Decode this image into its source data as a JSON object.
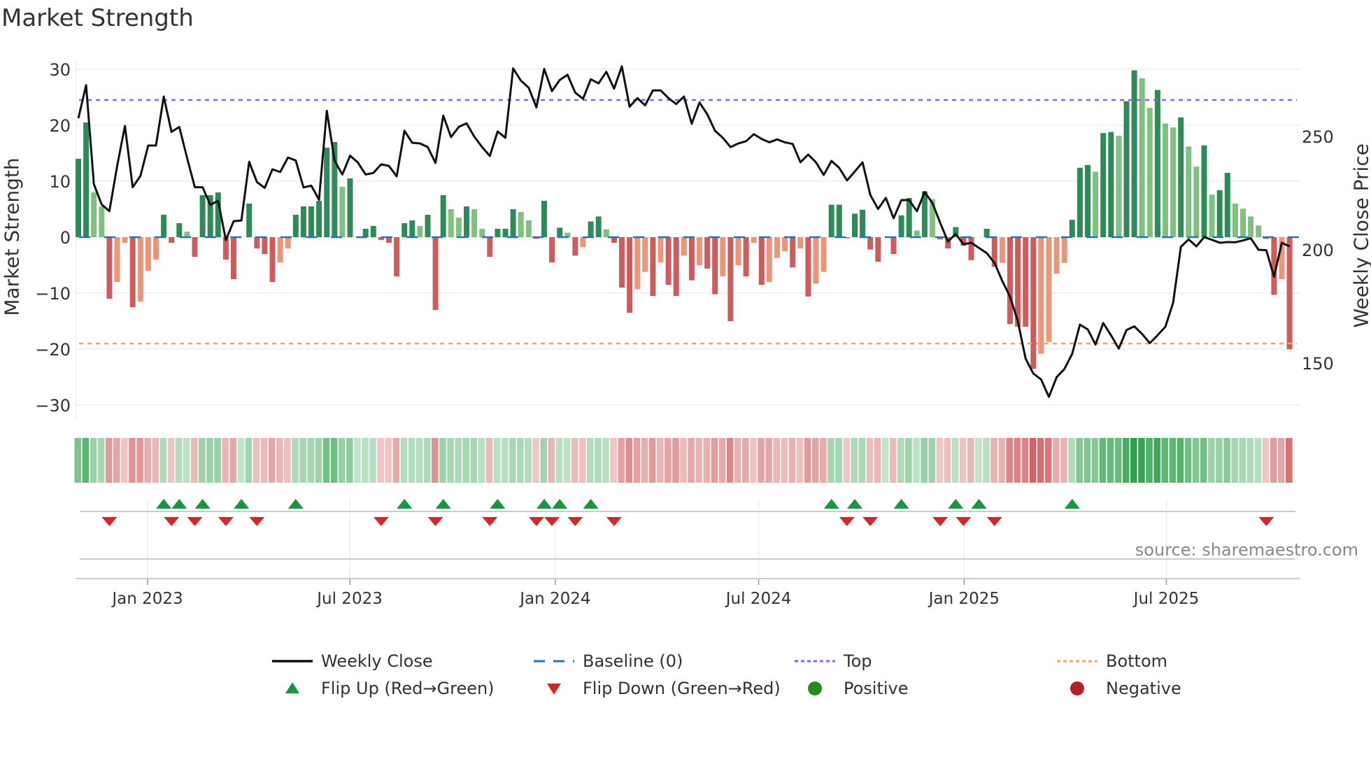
{
  "title": "Market Strength",
  "source": "source: sharemaestro.com",
  "legend": [
    {
      "label": "Weekly Close",
      "symbol": "line",
      "color": "#111111"
    },
    {
      "label": "Baseline (0)",
      "symbol": "dashed",
      "color": "#1f77b4"
    },
    {
      "label": "Top",
      "symbol": "dotted",
      "color": "#9b5de5"
    },
    {
      "label": "Bottom",
      "symbol": "dotted",
      "color": "#f4a261"
    },
    {
      "label": "Flip Up (Red→Green)",
      "symbol": "triangle-up",
      "color": "#1a9641"
    },
    {
      "label": "Flip Down (Green→Red)",
      "symbol": "triangle-down",
      "color": "#d62728"
    },
    {
      "label": "Positive",
      "symbol": "circle",
      "color": "#228b22"
    },
    {
      "label": "Negative",
      "symbol": "circle",
      "color": "#b22222"
    }
  ],
  "chart_data": {
    "type": "bar",
    "title": "Market Strength",
    "ylabel": "Market Strength",
    "y2label": "Weekly Close Price",
    "ylim": [
      -32,
      32
    ],
    "y2lim": [
      133.5,
      282
    ],
    "yticks": [
      30,
      20,
      10,
      0,
      -10,
      -20,
      -30
    ],
    "ytick_labels": [
      "30",
      "20",
      "10",
      "0",
      "−10",
      "−20",
      "−30"
    ],
    "y2ticks": [
      250,
      200,
      150
    ],
    "y2tick_labels": [
      "250",
      "200",
      "150"
    ],
    "xticks": [
      "Jan 2023",
      "Jul 2023",
      "Jan 2024",
      "Jul 2024",
      "Jan 2025",
      "Jul 2025"
    ],
    "xtick_days_from_2023_01_01": [
      0,
      181,
      365,
      547,
      731,
      912
    ],
    "frequency": "weekly",
    "top_level": 24.5,
    "bottom_level": -19,
    "baseline": 0,
    "colors": {
      "strong_pos": "#2e8b57",
      "weak_pos": "#80c080",
      "strong_neg": "#cd5c5c",
      "weak_neg": "#e9967a"
    },
    "strength": [
      14,
      20.5,
      8,
      5.5,
      -11,
      -8,
      -1,
      -12.5,
      -11.5,
      -6,
      -4,
      4,
      -1,
      2.5,
      1,
      -3.5,
      7.5,
      7.5,
      8,
      -4,
      -7.5,
      0,
      6,
      -2,
      -3,
      -8,
      -4.5,
      -2,
      4,
      5.5,
      5.5,
      6.5,
      16,
      17,
      9,
      10.5,
      0,
      1.5,
      2,
      -0.5,
      -1,
      -7,
      2.5,
      3,
      2,
      4,
      -13,
      7.5,
      5,
      3.5,
      5.5,
      5,
      1.5,
      -3.5,
      1.5,
      1.5,
      5,
      4.5,
      3,
      -0.3,
      6.5,
      -4.5,
      1.7,
      0.8,
      -3.3,
      -1.8,
      2.8,
      3.7,
      1.4,
      -1,
      -9,
      -13.5,
      -9.3,
      -6.2,
      -10.5,
      -4.5,
      -8.5,
      -10.5,
      -3.3,
      -7.7,
      -5,
      -5.6,
      -10.2,
      -7,
      -15,
      -5,
      -7,
      -1,
      -8.5,
      -8,
      -3.7,
      -2.5,
      -5.4,
      -2,
      -10.6,
      -8.3,
      -6.2,
      5.8,
      5.8,
      -0.2,
      4.2,
      4.9,
      -2.2,
      -4.4,
      0,
      -3,
      3.9,
      7,
      1.2,
      8.2,
      6.8,
      -0.4,
      -2,
      1.8,
      -1.5,
      -4.1,
      0,
      1.5,
      -5.3,
      -4.6,
      -15.5,
      -16,
      -16,
      -23.5,
      -20.8,
      -18.7,
      -6.5,
      -4.6,
      3.1,
      12.4,
      12.9,
      11.7,
      18.6,
      18.8,
      18.1,
      24.3,
      29.8,
      28.4,
      23.1,
      26.3,
      20.3,
      19.6,
      21.4,
      16.2,
      12.6,
      16.4,
      7.6,
      8.4,
      11.5,
      6,
      5.1,
      3.7,
      2.1,
      -0.3,
      -10.3,
      -7.5,
      -20
    ],
    "close": [
      258,
      272.6,
      229,
      220,
      217,
      237,
      254.6,
      227.6,
      232.6,
      246,
      246,
      267.6,
      252,
      254.2,
      240.6,
      227.6,
      227.6,
      219.8,
      221.6,
      204.3,
      212.6,
      212.9,
      238.8,
      229.9,
      227.3,
      235.5,
      234.3,
      240.7,
      239.4,
      227.5,
      228.3,
      222.1,
      261.3,
      239.3,
      233.2,
      241.5,
      238.5,
      233.2,
      233.9,
      237.7,
      237,
      232.4,
      252.5,
      247.2,
      246.9,
      245.3,
      238.3,
      259.2,
      249.7,
      254.2,
      255.8,
      249.9,
      245.3,
      241.4,
      252.2,
      249.4,
      280,
      274.6,
      271.5,
      262.8,
      279.8,
      270,
      274.9,
      277.2,
      269.3,
      266.6,
      275.2,
      273.4,
      278.5,
      271.1,
      280.9,
      263.1,
      266.9,
      263.7,
      270.3,
      270.3,
      266.9,
      264.3,
      267.6,
      255.6,
      265,
      259.8,
      252.5,
      249.4,
      245.3,
      246.9,
      247.9,
      251,
      248.9,
      247.4,
      248.7,
      247.4,
      246.7,
      238.6,
      242,
      238.6,
      233,
      239.2,
      236.1,
      230.6,
      234.5,
      238.6,
      224.2,
      218,
      222.9,
      213.9,
      221.9,
      221.9,
      217,
      225.5,
      220.6,
      211.9,
      203.6,
      207,
      202.4,
      203.1,
      200.8,
      198.5,
      194.2,
      186.2,
      179.3,
      168.5,
      152,
      145.4,
      142.8,
      135.1,
      143.8,
      147.4,
      154.1,
      167,
      164.9,
      158.2,
      167.7,
      162.3,
      156.4,
      164.6,
      166.2,
      162.9,
      158.8,
      162.3,
      166,
      176.6,
      201.3,
      204.6,
      201.5,
      205.6,
      204.4,
      203.1,
      203.4,
      203.3,
      204.1,
      205.1,
      200,
      199.8,
      188.1,
      203.1,
      201.5
    ],
    "flip_up_week_index": [
      11,
      13,
      16,
      21,
      28,
      42,
      47,
      54,
      60,
      62,
      66,
      97,
      100,
      106,
      113,
      116,
      128
    ],
    "flip_down_week_index": [
      4,
      12,
      15,
      19,
      23,
      39,
      46,
      53,
      59,
      61,
      64,
      69,
      99,
      102,
      111,
      114,
      118,
      153
    ]
  }
}
